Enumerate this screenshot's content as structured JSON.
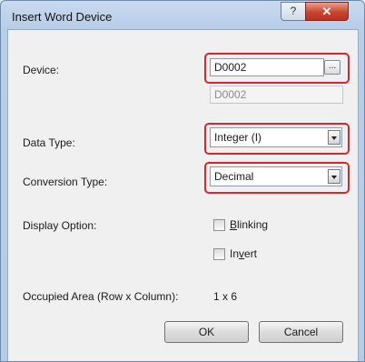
{
  "window": {
    "title": "Insert Word Device",
    "help_glyph": "?",
    "close_glyph": "✕"
  },
  "device": {
    "label": "Device:",
    "value": "D0002",
    "browse_label": "...",
    "preview_value": "D0002"
  },
  "data_type": {
    "label": "Data Type:",
    "selected": "Integer (I)"
  },
  "conversion_type": {
    "label": "Conversion Type:",
    "selected": "Decimal"
  },
  "display_option": {
    "label": "Display Option:",
    "blinking": {
      "label_mnemonic": "B",
      "label_rest": "linking",
      "checked": false
    },
    "invert": {
      "label_pre": "In",
      "label_mnemonic": "v",
      "label_post": "ert",
      "checked": false
    }
  },
  "occupied_area": {
    "label": "Occupied Area (Row x Column):",
    "value": "1 x 6"
  },
  "buttons": {
    "ok": "OK",
    "cancel": "Cancel"
  },
  "colors": {
    "highlight": "#d8262e",
    "titlebar": "#c9daf0",
    "close_button": "#c8452e"
  }
}
